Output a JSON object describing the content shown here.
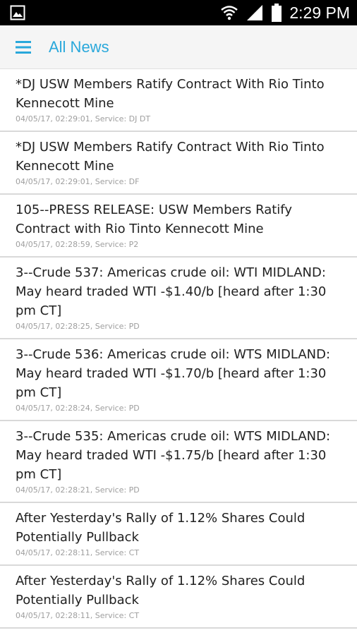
{
  "status_bar": {
    "time": "2:29 PM",
    "icons": [
      "gallery-icon",
      "wifi-icon",
      "signal-icon",
      "battery-icon"
    ]
  },
  "app_bar": {
    "menu_icon": "hamburger-menu-icon",
    "title": "All News",
    "accent_color": "#29a8db"
  },
  "news": [
    {
      "headline": "*DJ USW Members Ratify Contract With Rio Tinto Kennecott Mine",
      "meta": "04/05/17, 02:29:01, Service: DJ DT"
    },
    {
      "headline": "*DJ USW Members Ratify Contract With Rio Tinto Kennecott Mine",
      "meta": "04/05/17, 02:29:01, Service: DF"
    },
    {
      "headline": "105--PRESS RELEASE: USW Members Ratify Contract with Rio Tinto Kennecott Mine",
      "meta": "04/05/17, 02:28:59, Service: P2"
    },
    {
      "headline": "3--Crude 537: Americas crude oil: WTI MIDLAND: May heard traded WTI -$1.40/b [heard after 1:30 pm CT]",
      "meta": "04/05/17, 02:28:25, Service: PD"
    },
    {
      "headline": "3--Crude 536: Americas crude oil: WTS MIDLAND: May heard traded WTI -$1.70/b [heard after 1:30 pm CT]",
      "meta": "04/05/17, 02:28:24, Service: PD"
    },
    {
      "headline": "3--Crude 535: Americas crude oil: WTS MIDLAND: May heard traded WTI -$1.75/b [heard after 1:30 pm CT]",
      "meta": "04/05/17, 02:28:21, Service: PD"
    },
    {
      "headline": "After Yesterday's Rally of 1.12% Shares Could Potentially Pullback",
      "meta": "04/05/17, 02:28:11, Service: CT"
    },
    {
      "headline": "After Yesterday's Rally of 1.12% Shares Could Potentially Pullback",
      "meta": "04/05/17, 02:28:11, Service: CT"
    }
  ]
}
